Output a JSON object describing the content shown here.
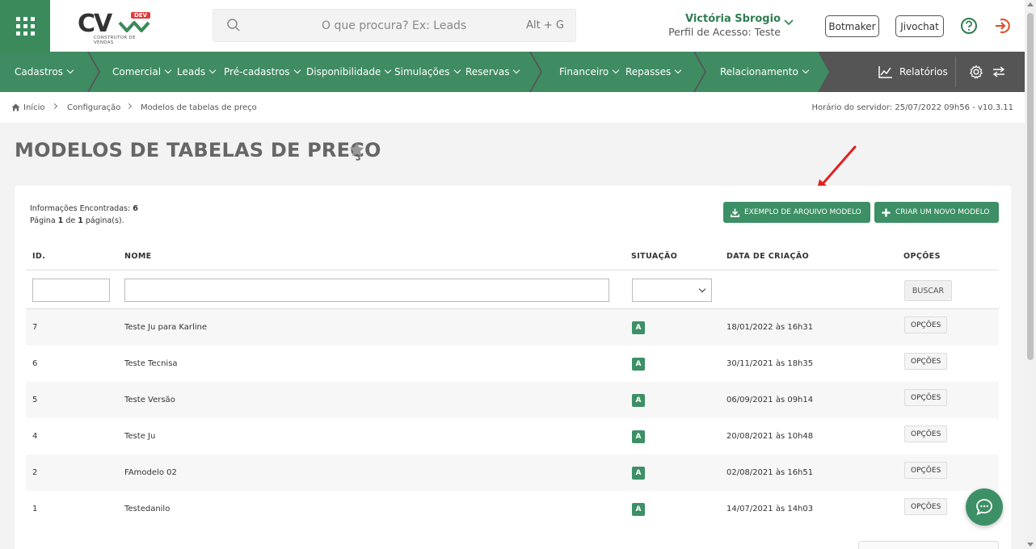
{
  "colors": {
    "brand_green": "#3a8a5c",
    "nav_green": "#3f8c63",
    "nav_dark": "#555555",
    "badge_green": "#3d8f66",
    "user_name": "#2e7d4f",
    "annotation_red": "#e02020",
    "logout_red": "#e04a2a"
  },
  "header": {
    "logo_text": "CV",
    "logo_badge": "DEV",
    "logo_subtitle": "CONSTRUTOR DE VENDAS",
    "search_placeholder": "O que procura? Ex: Leads",
    "search_shortcut": "Alt + G",
    "user_name": "Victória Sbrogio",
    "user_profile": "Perfil de Acesso: Teste",
    "buttons": [
      "Botmaker",
      "Jivochat"
    ]
  },
  "nav": {
    "items": [
      "Cadastros",
      "Comercial",
      "Leads",
      "Pré-cadastros",
      "Disponibilidade",
      "Simulações",
      "Reservas",
      "Financeiro",
      "Repasses",
      "Relacionamento"
    ],
    "reports": "Relatórios"
  },
  "breadcrumb": {
    "items": [
      "Início",
      "Configuração",
      "Modelos de tabelas de preço"
    ],
    "server_time": "Horário do servidor: 25/07/2022 09h56 - v10.3.11"
  },
  "page": {
    "title": "MODELOS DE TABELAS DE PREÇO"
  },
  "card": {
    "info_found_label": "Informações Encontradas:",
    "info_found_value": "6",
    "page_word": "Página",
    "page_current": "1",
    "page_of": "de",
    "page_total": "1",
    "page_suffix": "página(s).",
    "example_button": "EXEMPLO DE ARQUIVO MODELO",
    "create_button": "CRIAR UM NOVO MODELO",
    "search_button": "BUSCAR"
  },
  "table": {
    "columns": [
      "ID.",
      "NOME",
      "SITUAÇÃO",
      "DATA DE CRIAÇÃO",
      "OPÇÕES"
    ],
    "rows": [
      {
        "id": "7",
        "name": "Teste Ju para Karline",
        "status": "A",
        "date": "18/01/2022 às 16h31",
        "options": "OPÇÕES"
      },
      {
        "id": "6",
        "name": "Teste Tecnisa",
        "status": "A",
        "date": "30/11/2021 às 18h35",
        "options": "OPÇÕES"
      },
      {
        "id": "5",
        "name": "Teste Versão",
        "status": "A",
        "date": "06/09/2021 às 09h14",
        "options": "OPÇÕES"
      },
      {
        "id": "4",
        "name": "Teste Ju",
        "status": "A",
        "date": "20/08/2021 às 10h48",
        "options": "OPÇÕES"
      },
      {
        "id": "2",
        "name": "FAmodelo 02",
        "status": "A",
        "date": "02/08/2021 às 16h51",
        "options": "OPÇÕES"
      },
      {
        "id": "1",
        "name": "Testedanilo",
        "status": "A",
        "date": "14/07/2021 às 14h03",
        "options": "OPÇÕES"
      }
    ]
  },
  "icons": {
    "apps": "grid-icon",
    "search": "search-icon",
    "help": "help-circle-icon",
    "logout": "logout-icon",
    "reports": "chart-line-icon",
    "settings": "gear-icon",
    "swap": "swap-arrows-icon",
    "home": "home-icon",
    "favorite": "star-icon",
    "download": "download-icon",
    "plus": "plus-icon",
    "chat": "chat-icon"
  }
}
